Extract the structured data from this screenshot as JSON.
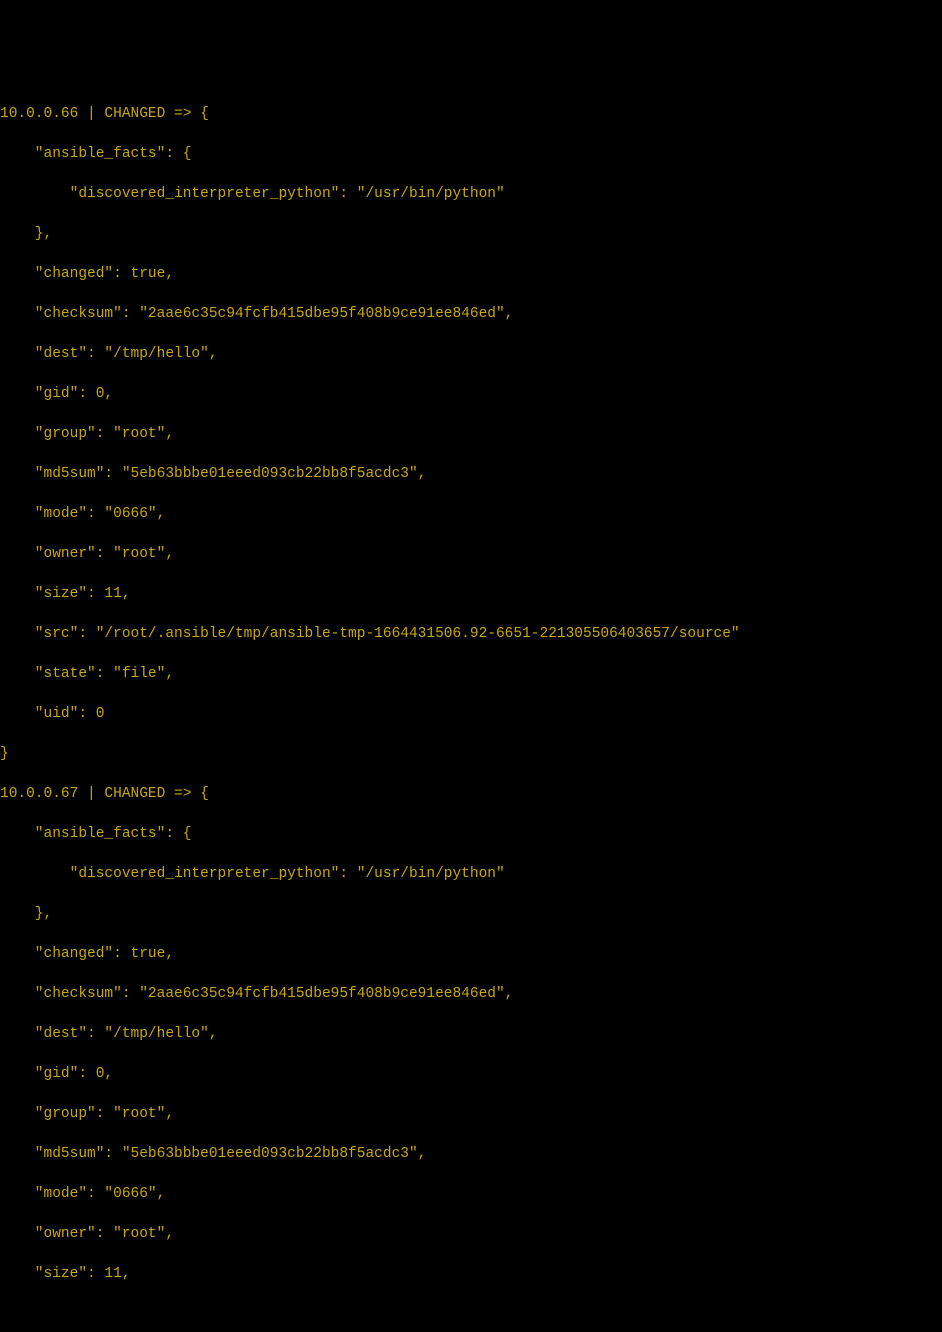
{
  "hosts": [
    {
      "ip": "10.0.0.66",
      "status": "CHANGED",
      "ansible_facts": {
        "discovered_interpreter_python": "/usr/bin/python"
      },
      "changed": true,
      "checksum": "2aae6c35c94fcfb415dbe95f408b9ce91ee846ed",
      "dest": "/tmp/hello",
      "gid": 0,
      "group": "root",
      "md5sum": "5eb63bbbe01eeed093cb22bb8f5acdc3",
      "mode": "0666",
      "owner": "root",
      "size": 11,
      "src": "/root/.ansible/tmp/ansible-tmp-1664431506.92-6651-221305506403657/source",
      "state": "file",
      "uid": 0
    },
    {
      "ip": "10.0.0.67",
      "status": "CHANGED",
      "ansible_facts": {
        "discovered_interpreter_python": "/usr/bin/python"
      },
      "changed": true,
      "checksum": "2aae6c35c94fcfb415dbe95f408b9ce91ee846ed",
      "dest": "/tmp/hello",
      "gid": 0,
      "group": "root",
      "md5sum": "5eb63bbbe01eeed093cb22bb8f5acdc3",
      "mode": "0666",
      "owner": "root",
      "size": 11
    }
  ]
}
